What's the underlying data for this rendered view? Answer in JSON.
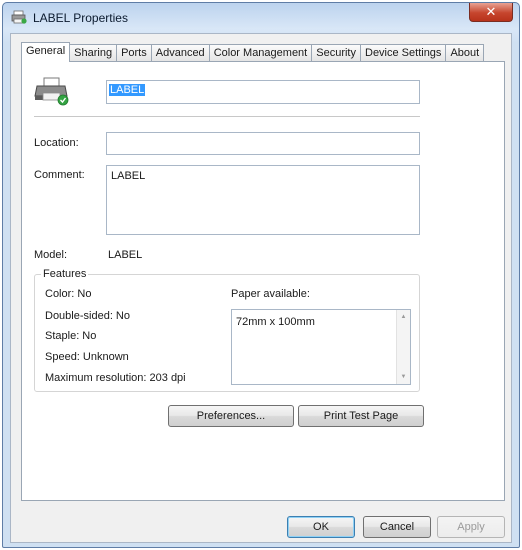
{
  "window": {
    "title": "LABEL Properties",
    "close_glyph": "✕"
  },
  "tabs": [
    {
      "label": "General",
      "active": true
    },
    {
      "label": "Sharing"
    },
    {
      "label": "Ports"
    },
    {
      "label": "Advanced"
    },
    {
      "label": "Color Management"
    },
    {
      "label": "Security"
    },
    {
      "label": "Device Settings"
    },
    {
      "label": "About"
    }
  ],
  "general": {
    "printer_icon": "printer-icon",
    "printer_name": "LABEL",
    "location_label": "Location:",
    "location_value": "",
    "comment_label": "Comment:",
    "comment_value": "LABEL",
    "model_label": "Model:",
    "model_value": "LABEL"
  },
  "features": {
    "legend": "Features",
    "color": "Color: No",
    "double_sided": "Double-sided: No",
    "staple": "Staple: No",
    "speed": "Speed: Unknown",
    "max_resolution": "Maximum resolution: 203 dpi",
    "paper_label": "Paper available:",
    "paper_items": [
      "72mm x 100mm"
    ]
  },
  "buttons": {
    "preferences": "Preferences...",
    "print_test_page": "Print Test Page",
    "ok": "OK",
    "cancel": "Cancel",
    "apply": "Apply"
  }
}
